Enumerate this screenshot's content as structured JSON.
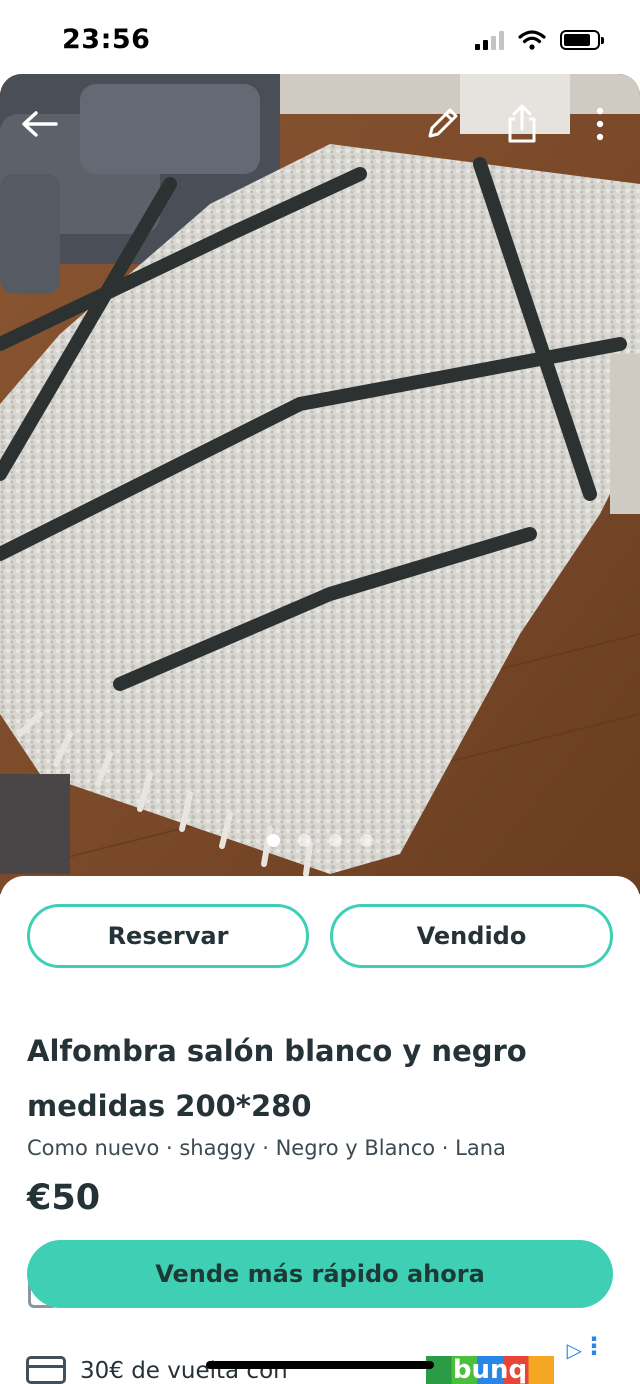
{
  "status_bar": {
    "time": "23:56"
  },
  "toolbar": {
    "icons": [
      "back-arrow-icon",
      "edit-pencil-icon",
      "share-icon",
      "more-vertical-icon"
    ]
  },
  "gallery": {
    "image_count": 4,
    "active_index": 0
  },
  "actions": {
    "reserve_label": "Reservar",
    "sold_label": "Vendido"
  },
  "listing": {
    "title": "Alfombra salón blanco y negro medidas 200*280",
    "attributes": "Como nuevo · shaggy · Negro y Blanco · Lana",
    "price": "€50"
  },
  "promo": {
    "cta_label": "Vende más rápido ahora"
  },
  "ad": {
    "text": "30€ de vuelta con",
    "brand": "bunq"
  },
  "colors": {
    "accent": "#3fcfb4",
    "text": "#253238",
    "ad_blue": "#2a86e6"
  }
}
